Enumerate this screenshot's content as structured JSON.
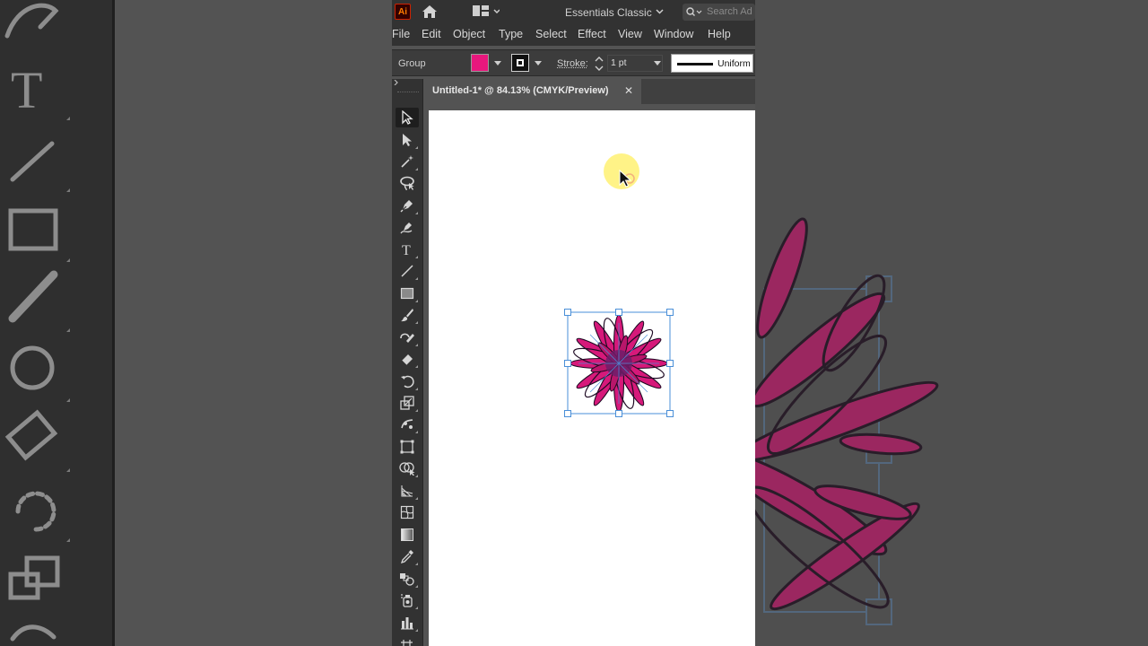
{
  "app": {
    "logo": "Ai",
    "workspace": "Essentials Classic",
    "search_placeholder": "Search Ad"
  },
  "menu": [
    "File",
    "Edit",
    "Object",
    "Type",
    "Select",
    "Effect",
    "View",
    "Window",
    "Help"
  ],
  "control_bar": {
    "selection_type": "Group",
    "fill_color": "#e8177d",
    "stroke_label": "Stroke:",
    "stroke_weight": "1 pt",
    "profile_label": "Uniform"
  },
  "document": {
    "tab_title": "Untitled-1* @ 84.13% (CMYK/Preview)",
    "close_glyph": "✕"
  },
  "tools": [
    "selection-tool-icon",
    "direct-selection-tool-icon",
    "magic-wand-tool-icon",
    "lasso-tool-icon",
    "pen-tool-icon",
    "curvature-tool-icon",
    "type-tool-icon",
    "line-segment-tool-icon",
    "rectangle-tool-icon",
    "paintbrush-tool-icon",
    "shaper-tool-icon",
    "eraser-tool-icon",
    "rotate-tool-icon",
    "scale-tool-icon",
    "puppet-warp-tool-icon",
    "free-transform-tool-icon",
    "shape-builder-tool-icon",
    "perspective-grid-tool-icon",
    "mesh-tool-icon",
    "gradient-tool-icon",
    "eyedropper-tool-icon",
    "blend-tool-icon",
    "symbol-sprayer-tool-icon",
    "column-graph-tool-icon"
  ],
  "colors": {
    "accent_magenta": "#e8177d",
    "stroke_dark": "#2a1430",
    "selection_blue": "#4a8fd8",
    "cursor_highlight": "#fff27a",
    "app_logo_bg": "#cc2200"
  }
}
